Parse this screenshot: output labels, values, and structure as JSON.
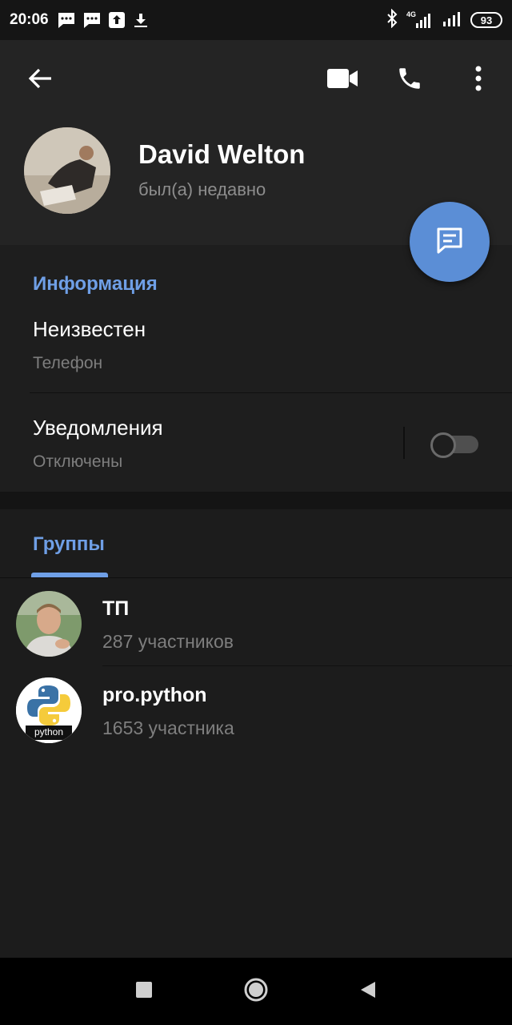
{
  "status_bar": {
    "time": "20:06",
    "network": "4G",
    "battery": "93",
    "icons": [
      "message-icon",
      "message-icon",
      "upload-icon",
      "download-icon",
      "bluetooth-icon",
      "signal-icon",
      "signal-icon"
    ]
  },
  "toolbar": {
    "back_icon": "arrow-left-icon",
    "video_icon": "video-camera-icon",
    "call_icon": "phone-icon",
    "menu_icon": "more-vertical-icon"
  },
  "profile": {
    "name": "David Welton",
    "status": "был(а) недавно"
  },
  "fab": {
    "icon": "message-icon",
    "color": "#5b8ed6"
  },
  "info": {
    "title": "Информация",
    "phone_value": "Неизвестен",
    "phone_label": "Телефон",
    "notifications_label": "Уведомления",
    "notifications_value": "Отключены",
    "notifications_enabled": false
  },
  "groups": {
    "tab_label": "Группы",
    "items": [
      {
        "name": "ТП",
        "members": "287 участников"
      },
      {
        "name": "pro.python",
        "members": "1653 участника",
        "logo_text": "python"
      }
    ]
  },
  "colors": {
    "accent": "#6f9fe6",
    "background": "#1a1a1a",
    "header": "#242424"
  }
}
